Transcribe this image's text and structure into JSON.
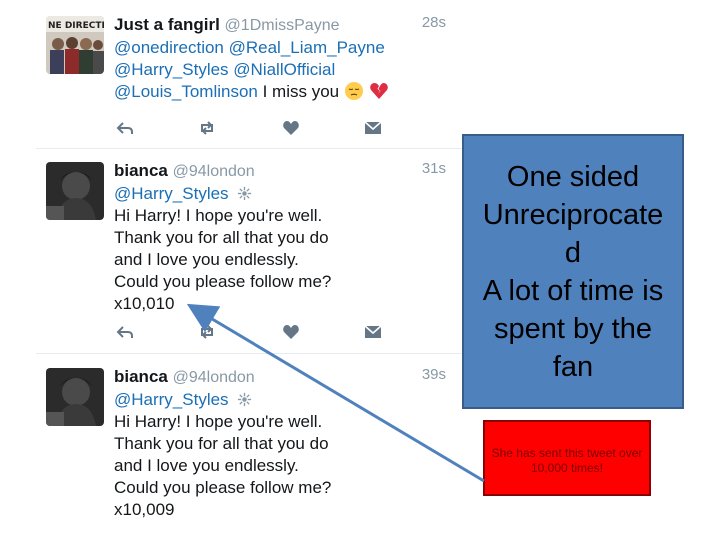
{
  "tweets": [
    {
      "name": "Just a fangirl",
      "handle": "@1DmissPayne",
      "time": "28s",
      "lines": [
        "@onedirection @Real_Liam_Payne",
        "@Harry_Styles @NiallOfficial"
      ],
      "last_line_mention": "@Louis_Tomlinson",
      "last_line_text": " I miss you"
    },
    {
      "name": "bianca",
      "handle": "@94london",
      "time": "31s",
      "mention": "@Harry_Styles",
      "lines": [
        "Hi Harry! I hope you're well.",
        "Thank you for all that you do",
        "and I love you endlessly.",
        "Could you please follow me?",
        "x10,010"
      ]
    },
    {
      "name": "bianca",
      "handle": "@94london",
      "time": "39s",
      "mention": "@Harry_Styles",
      "lines": [
        "Hi Harry! I hope you're well.",
        "Thank you for all that you do",
        "and I love you endlessly.",
        "Could you please follow me?",
        "x10,009"
      ]
    }
  ],
  "annotation": {
    "lines": [
      "One sided",
      "Unreciprocate",
      "d",
      "A lot of time is",
      "spent by the",
      "fan"
    ],
    "note": "She has sent this tweet over 10,000 times!"
  },
  "colors": {
    "mention": "#1b6fb5",
    "annotation_box": "#4f81bd",
    "note_box": "#ff0000",
    "arrow": "#4f81bd"
  },
  "icons": [
    "reply-icon",
    "retweet-icon",
    "like-icon",
    "dm-icon",
    "pensive-emoji-icon",
    "broken-heart-icon",
    "sunflower-badge-icon"
  ]
}
